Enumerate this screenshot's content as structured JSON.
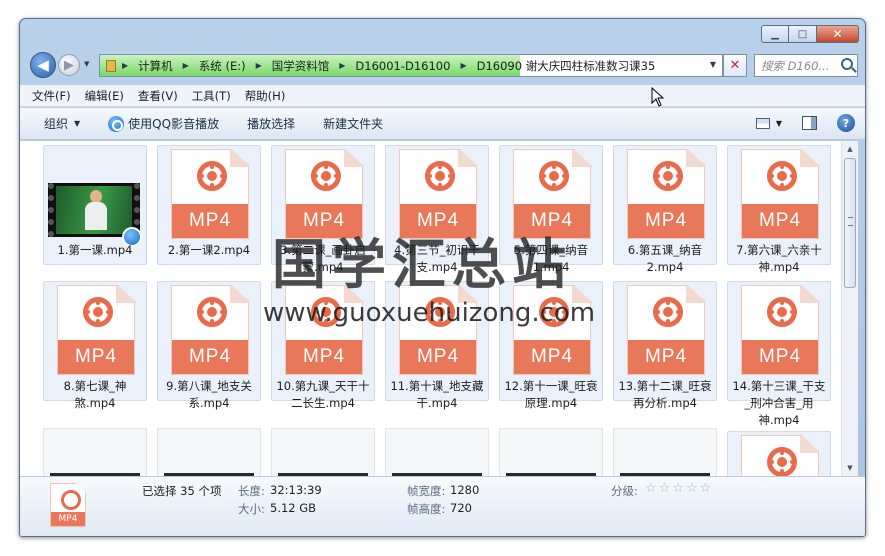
{
  "window": {
    "buttons": {
      "minimize": "▁",
      "maximize": "□",
      "close": "✕"
    }
  },
  "nav": {
    "back": "◀",
    "forward": "▶",
    "recent": "▼"
  },
  "address": {
    "crumbs": [
      "计算机",
      "系统 (E:)",
      "国学资料馆",
      "D16001-D16100",
      "D16090 谢大庆四柱标准数习课35"
    ],
    "separator": "▶",
    "dropdown": "▼",
    "close": "✕"
  },
  "search": {
    "placeholder": "搜索 D160..."
  },
  "menubar": [
    "文件(F)",
    "编辑(E)",
    "查看(V)",
    "工具(T)",
    "帮助(H)"
  ],
  "toolbar": {
    "organize": "组织",
    "dropdown": "▼",
    "play_qq": "使用QQ影音播放",
    "play_selected": "播放选择",
    "new_folder": "新建文件夹",
    "help": "?"
  },
  "files": [
    {
      "name": "1.第一课.mp4",
      "kind": "video"
    },
    {
      "name": "2.第一课2.mp4",
      "kind": "mp4"
    },
    {
      "name": "3.第二课_画卦启蒙.mp4",
      "kind": "mp4"
    },
    {
      "name": "4.第三节_初识干支.mp4",
      "kind": "mp4"
    },
    {
      "name": "5.第四课_纳音1.mp4",
      "kind": "mp4"
    },
    {
      "name": "6.第五课_纳音2.mp4",
      "kind": "mp4"
    },
    {
      "name": "7.第六课_六亲十神.mp4",
      "kind": "mp4"
    },
    {
      "name": "8.第七课_神煞.mp4",
      "kind": "mp4"
    },
    {
      "name": "9.第八课_地支关系.mp4",
      "kind": "mp4"
    },
    {
      "name": "10.第九课_天干十二长生.mp4",
      "kind": "mp4"
    },
    {
      "name": "11.第十课_地支藏干.mp4",
      "kind": "mp4"
    },
    {
      "name": "12.第十一课_旺衰原理.mp4",
      "kind": "mp4"
    },
    {
      "name": "13.第十二课_旺衰再分析.mp4",
      "kind": "mp4"
    },
    {
      "name": "14.第十三课_干支_刑冲合害_用神.mp4",
      "kind": "mp4"
    }
  ],
  "badge_text": "MP4",
  "details": {
    "selected": "已选择 35 个项",
    "length_k": "长度:",
    "length_v": "32:13:39",
    "size_k": "大小:",
    "size_v": "5.12 GB",
    "fw_k": "帧宽度:",
    "fw_v": "1280",
    "fh_k": "帧高度:",
    "fh_v": "720",
    "rating_k": "分级:",
    "stars": [
      "☆",
      "☆",
      "☆",
      "☆",
      "☆"
    ],
    "thumb_label": "MP4"
  },
  "scroll": {
    "up": "▲",
    "down": "▼"
  },
  "watermark": {
    "cn": "国学汇总站",
    "url": "www.guoxuehuizong.com"
  }
}
